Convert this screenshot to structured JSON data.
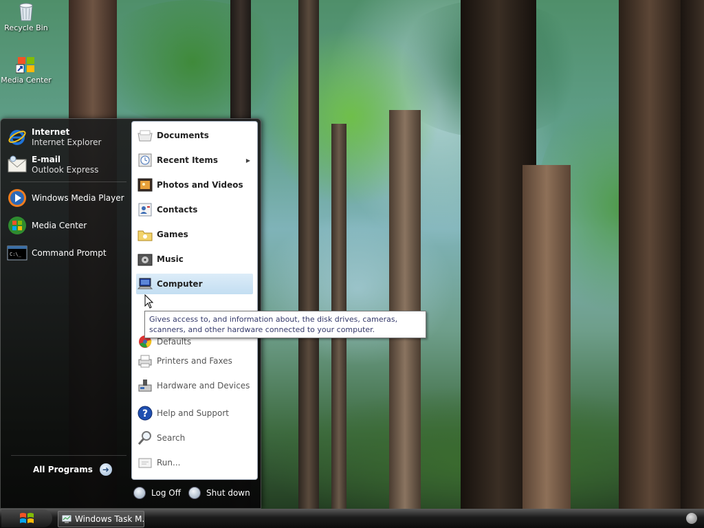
{
  "desktop": {
    "icons": [
      {
        "label": "Recycle Bin",
        "icon": "recycle-bin-icon"
      },
      {
        "label": "Media Center",
        "icon": "media-center-shortcut-icon"
      }
    ]
  },
  "start_menu": {
    "pinned": [
      {
        "title": "Internet",
        "subtitle": "Internet Explorer",
        "icon": "internet-explorer-icon"
      },
      {
        "title": "E-mail",
        "subtitle": "Outlook Express",
        "icon": "email-icon"
      }
    ],
    "recent": [
      {
        "label": "Windows Media Player",
        "icon": "windows-media-player-icon"
      },
      {
        "label": "Media Center",
        "icon": "media-center-icon"
      },
      {
        "label": "Command Prompt",
        "icon": "command-prompt-icon"
      }
    ],
    "all_programs": "All Programs",
    "right_items": [
      {
        "label": "Documents",
        "icon": "documents-icon"
      },
      {
        "label": "Recent Items",
        "icon": "recent-items-icon"
      },
      {
        "label": "Photos and Videos",
        "icon": "photos-icon"
      },
      {
        "label": "Contacts",
        "icon": "contacts-icon"
      },
      {
        "label": "Games",
        "icon": "games-icon"
      },
      {
        "label": "Music",
        "icon": "music-icon"
      },
      {
        "label": "Computer",
        "icon": "computer-icon"
      },
      {
        "label": "Defaults",
        "icon": "default-programs-icon"
      },
      {
        "label": "Printers and Faxes",
        "icon": "printers-icon"
      },
      {
        "label": "Hardware and Devices",
        "icon": "hardware-icon"
      },
      {
        "label": "Help and Support",
        "icon": "help-icon"
      },
      {
        "label": "Search",
        "icon": "search-icon"
      },
      {
        "label": "Run...",
        "icon": "run-icon"
      }
    ],
    "log_off": "Log Off",
    "shut_down": "Shut down",
    "tooltip": "Gives access to, and information about, the disk drives, cameras, scanners, and other hardware connected to your computer."
  },
  "taskbar": {
    "task_label": "Windows Task M..."
  },
  "colors": {
    "highlight": "#c3def2",
    "menu_dark": "#141414",
    "tooltip_text": "#33386a"
  }
}
